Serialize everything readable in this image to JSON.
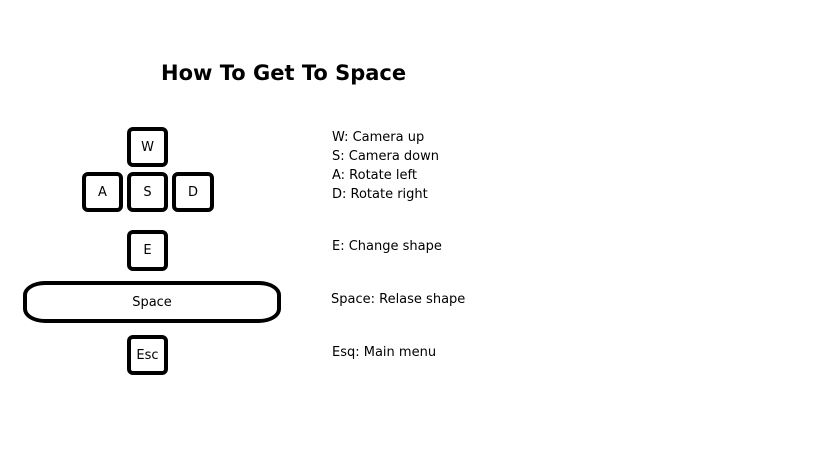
{
  "title": "How To Get To Space",
  "keys": {
    "w": "W",
    "a": "A",
    "s": "S",
    "d": "D",
    "e": "E",
    "space": "Space",
    "esc": "Esc"
  },
  "descriptions": {
    "camera_up": "W: Camera up",
    "camera_down": "S: Camera down",
    "rotate_left": "A: Rotate left",
    "rotate_right": "D: Rotate right",
    "change_shape": "E: Change shape",
    "release_shape": "Space: Relase shape",
    "main_menu": "Esq: Main menu"
  }
}
